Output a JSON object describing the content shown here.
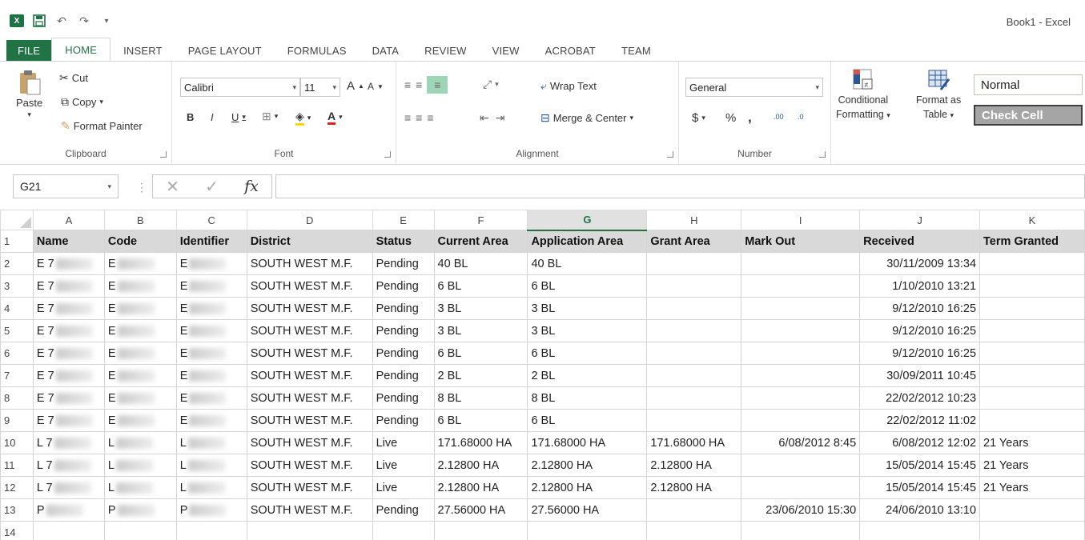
{
  "app": {
    "title": "Book1 - Excel",
    "logo": "X"
  },
  "tabs": [
    "FILE",
    "HOME",
    "INSERT",
    "PAGE LAYOUT",
    "FORMULAS",
    "DATA",
    "REVIEW",
    "VIEW",
    "ACROBAT",
    "TEAM"
  ],
  "active_tab": "HOME",
  "ribbon": {
    "clipboard": {
      "label": "Clipboard",
      "paste": "Paste",
      "cut": "Cut",
      "copy": "Copy",
      "format_painter": "Format Painter"
    },
    "font": {
      "label": "Font",
      "family": "Calibri",
      "size": "11",
      "bold": "B",
      "italic": "I",
      "underline": "U",
      "grow": "A",
      "shrink": "A"
    },
    "alignment": {
      "label": "Alignment",
      "wrap_text": "Wrap Text",
      "merge_center": "Merge & Center"
    },
    "number": {
      "label": "Number",
      "format": "General",
      "currency": "$",
      "percent": "%",
      "comma": ",",
      "inc_decimal": ".00",
      "dec_decimal": ".0"
    },
    "styles": {
      "conditional_1": "Conditional",
      "conditional_2": "Formatting",
      "format_as_1": "Format as",
      "format_as_2": "Table",
      "style_normal": "Normal",
      "style_check_cell": "Check Cell"
    }
  },
  "formula_bar": {
    "name_box": "G21",
    "fx": "fx",
    "value": ""
  },
  "colors": {
    "excel_green": "#217346",
    "header_fill": "#d9d9d9",
    "check_cell": "#a5a5a5"
  },
  "grid": {
    "columns": [
      "A",
      "B",
      "C",
      "D",
      "E",
      "F",
      "G",
      "H",
      "I",
      "J",
      "K"
    ],
    "selected_column": "G",
    "row_numbers": [
      "1",
      "2",
      "3",
      "4",
      "5",
      "6",
      "7",
      "8",
      "9",
      "10",
      "11",
      "12",
      "13",
      "14"
    ],
    "headers": [
      "Name",
      "Code",
      "Identifier",
      "District",
      "Status",
      "Current Area",
      "Application Area",
      "Grant Area",
      "Mark Out",
      "Received",
      "Term Granted"
    ],
    "rows": [
      [
        "E 7",
        "E",
        "E",
        "SOUTH WEST M.F.",
        "Pending",
        "40 BL",
        "40 BL",
        "",
        "",
        "30/11/2009 13:34",
        ""
      ],
      [
        "E 7",
        "E",
        "E",
        "SOUTH WEST M.F.",
        "Pending",
        "6 BL",
        "6 BL",
        "",
        "",
        "1/10/2010 13:21",
        ""
      ],
      [
        "E 7",
        "E",
        "E",
        "SOUTH WEST M.F.",
        "Pending",
        "3 BL",
        "3 BL",
        "",
        "",
        "9/12/2010 16:25",
        ""
      ],
      [
        "E 7",
        "E",
        "E",
        "SOUTH WEST M.F.",
        "Pending",
        "3 BL",
        "3 BL",
        "",
        "",
        "9/12/2010 16:25",
        ""
      ],
      [
        "E 7",
        "E",
        "E",
        "SOUTH WEST M.F.",
        "Pending",
        "6 BL",
        "6 BL",
        "",
        "",
        "9/12/2010 16:25",
        ""
      ],
      [
        "E 7",
        "E",
        "E",
        "SOUTH WEST M.F.",
        "Pending",
        "2 BL",
        "2 BL",
        "",
        "",
        "30/09/2011 10:45",
        ""
      ],
      [
        "E 7",
        "E",
        "E",
        "SOUTH WEST M.F.",
        "Pending",
        "8 BL",
        "8 BL",
        "",
        "",
        "22/02/2012 10:23",
        ""
      ],
      [
        "E 7",
        "E",
        "E",
        "SOUTH WEST M.F.",
        "Pending",
        "6 BL",
        "6 BL",
        "",
        "",
        "22/02/2012 11:02",
        ""
      ],
      [
        "L 7",
        "L",
        "L",
        "SOUTH WEST M.F.",
        "Live",
        "171.68000 HA",
        "171.68000 HA",
        "171.68000 HA",
        "6/08/2012 8:45",
        "6/08/2012 12:02",
        "21 Years"
      ],
      [
        "L 7",
        "L",
        "L",
        "SOUTH WEST M.F.",
        "Live",
        "2.12800 HA",
        "2.12800 HA",
        "2.12800 HA",
        "",
        "15/05/2014 15:45",
        "21 Years"
      ],
      [
        "L 7",
        "L",
        "L",
        "SOUTH WEST M.F.",
        "Live",
        "2.12800 HA",
        "2.12800 HA",
        "2.12800 HA",
        "",
        "15/05/2014 15:45",
        "21 Years"
      ],
      [
        "P",
        "P",
        "P",
        "SOUTH WEST M.F.",
        "Pending",
        "27.56000 HA",
        "27.56000 HA",
        "",
        "23/06/2010 15:30",
        "24/06/2010 13:10",
        ""
      ],
      [
        "",
        "",
        "",
        "",
        "",
        "",
        "",
        "",
        "",
        "",
        ""
      ]
    ]
  }
}
